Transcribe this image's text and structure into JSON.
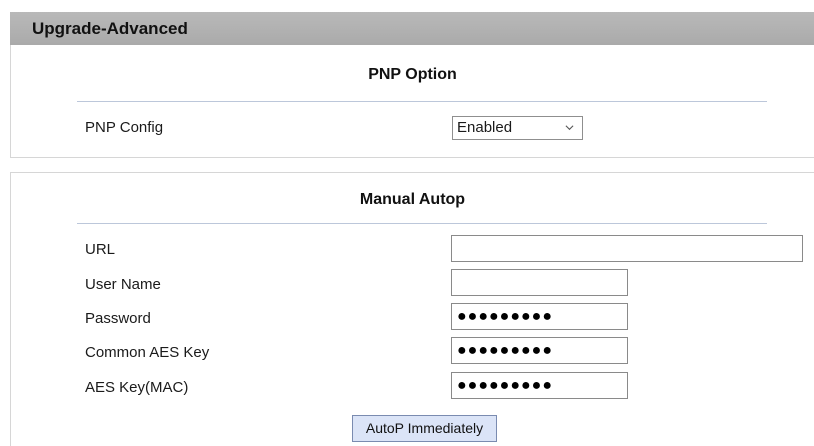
{
  "header": {
    "title": "Upgrade-Advanced"
  },
  "pnp": {
    "title": "PNP Option",
    "config_label": "PNP Config",
    "config_value": "Enabled"
  },
  "manual": {
    "title": "Manual Autop",
    "fields": [
      {
        "label": "URL",
        "value": ""
      },
      {
        "label": "User Name",
        "value": ""
      },
      {
        "label": "Password",
        "value": "●●●●●●●●●"
      },
      {
        "label": "Common AES Key",
        "value": "●●●●●●●●●"
      },
      {
        "label": "AES Key(MAC)",
        "value": "●●●●●●●●●"
      }
    ],
    "button_label": "AutoP Immediately"
  }
}
